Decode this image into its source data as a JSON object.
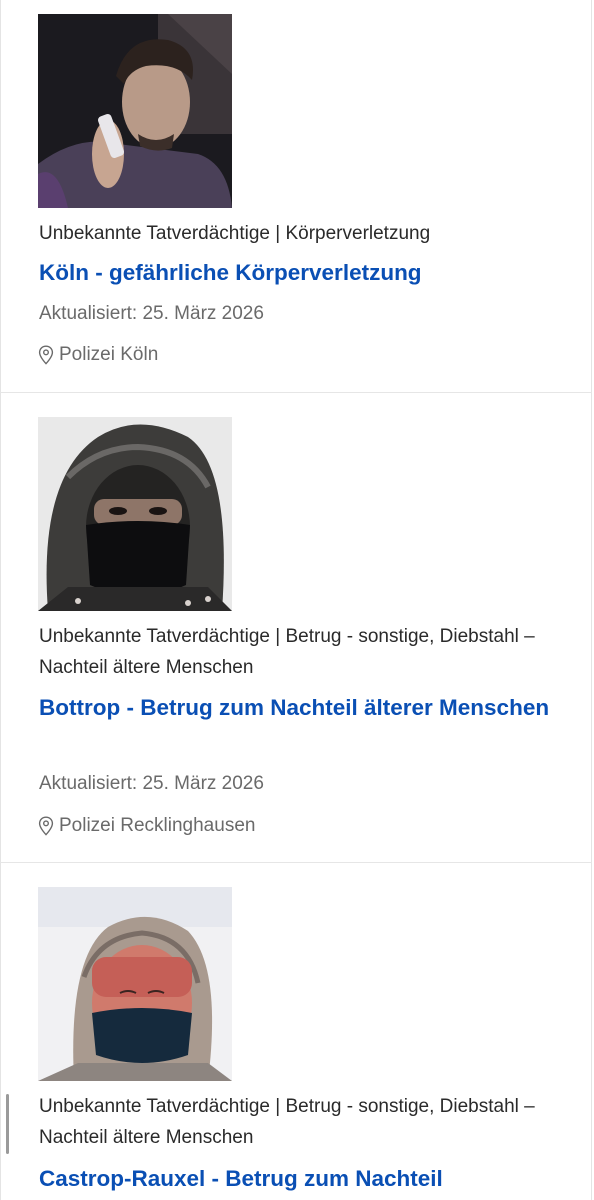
{
  "cards": [
    {
      "categories": "Unbekannte Tatverdächtige | Körperverletzung",
      "title": "Köln - gefährliche Körperverletzung",
      "updated": "Aktualisiert: 25. März 2026",
      "agency": "Polizei Köln"
    },
    {
      "categories": "Unbekannte Tatverdächtige | Betrug - sonstige, Diebstahl – Nachteil ältere Menschen",
      "title": "Bottrop - Betrug zum Nachteil älterer Menschen",
      "updated": "Aktualisiert: 25. März 2026",
      "agency": "Polizei Recklinghausen"
    },
    {
      "categories": "Unbekannte Tatverdächtige | Betrug - sonstige, Diebstahl – Nachteil ältere Menschen",
      "title": "Castrop-Rauxel - Betrug zum Nachteil"
    }
  ],
  "colors": {
    "link": "#0a4fb4",
    "meta": "#6a6a6a",
    "text": "#2a2a2a"
  },
  "icons": {
    "location": "map-pin-outline-icon"
  }
}
